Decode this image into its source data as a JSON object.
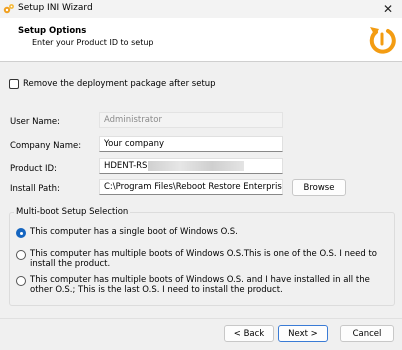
{
  "window": {
    "title": "Setup INI Wizard",
    "close_glyph": "✕"
  },
  "header": {
    "title": "Setup Options",
    "subtitle": "Enter your Product ID to setup",
    "logo_icon": "power-refresh-icon"
  },
  "remove_package": {
    "label": "Remove the deployment package after setup",
    "checked": false
  },
  "fields": {
    "user_name": {
      "label": "User Name:",
      "value": "Administrator"
    },
    "company_name": {
      "label": "Company Name:",
      "value": "Your company"
    },
    "product_id": {
      "label": "Product ID:",
      "value": "HDENT-RS"
    },
    "install_path": {
      "label": "Install Path:",
      "value": "C:\\Program Files\\Reboot Restore Enterprise"
    }
  },
  "browse_label": "Browse",
  "multiboot": {
    "title": "Multi-boot Setup Selection",
    "options": [
      {
        "label": "This computer has a single boot of Windows O.S.",
        "checked": true
      },
      {
        "label": "This computer has multiple boots of Windows O.S.This is one of the O.S. I need to install the product.",
        "checked": false
      },
      {
        "label": "This computer has multiple boots of Windows O.S. and I have installed in all the other O.S.; This is the last O.S. I need to install the product.",
        "checked": false
      }
    ]
  },
  "buttons": {
    "back": "< Back",
    "next": "Next >",
    "cancel": "Cancel"
  },
  "colors": {
    "accent": "#1565c0",
    "logo_orange": "#f39c12"
  }
}
